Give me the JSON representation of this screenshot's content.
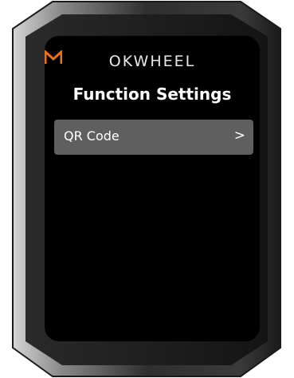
{
  "brand": {
    "logo_text": "OKWHEEL",
    "logo_mark": "M",
    "accent_color": "#e8731e"
  },
  "screen": {
    "title": "Function Settings",
    "menu": [
      {
        "label": "QR Code",
        "chevron": ">"
      }
    ]
  },
  "icons": [
    "mokwheel-logo-icon",
    "chevron-right-icon"
  ]
}
